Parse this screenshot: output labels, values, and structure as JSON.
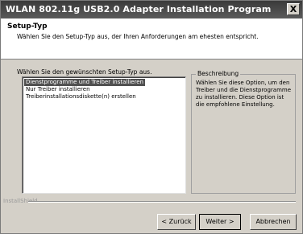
{
  "window": {
    "title": "WLAN 802.11g USB2.0 Adapter Installation Program",
    "close_glyph": "X"
  },
  "header": {
    "title": "Setup-Typ",
    "description": "Wählen Sie den Setup-Typ aus, der Ihren Anforderungen am ehesten entspricht."
  },
  "main": {
    "prompt": "Wählen Sie den gewünschten Setup-Typ aus.",
    "options": [
      {
        "label": "Dienstprogramme und Treiber installieren",
        "selected": true
      },
      {
        "label": "Nur Treiber installieren",
        "selected": false
      },
      {
        "label": "Treiberinstallationsdiskette(n) erstellen",
        "selected": false
      }
    ],
    "description_group": {
      "title": "Beschreibung",
      "text": "Wählen Sie diese Option, um den Treiber und die Dienstprogramme zu installieren. Diese Option ist die empfohlene Einstellung."
    }
  },
  "footer": {
    "brand": "InstallShield",
    "buttons": {
      "back": "< Zurück",
      "next": "Weiter >",
      "cancel": "Abbrechen"
    }
  }
}
